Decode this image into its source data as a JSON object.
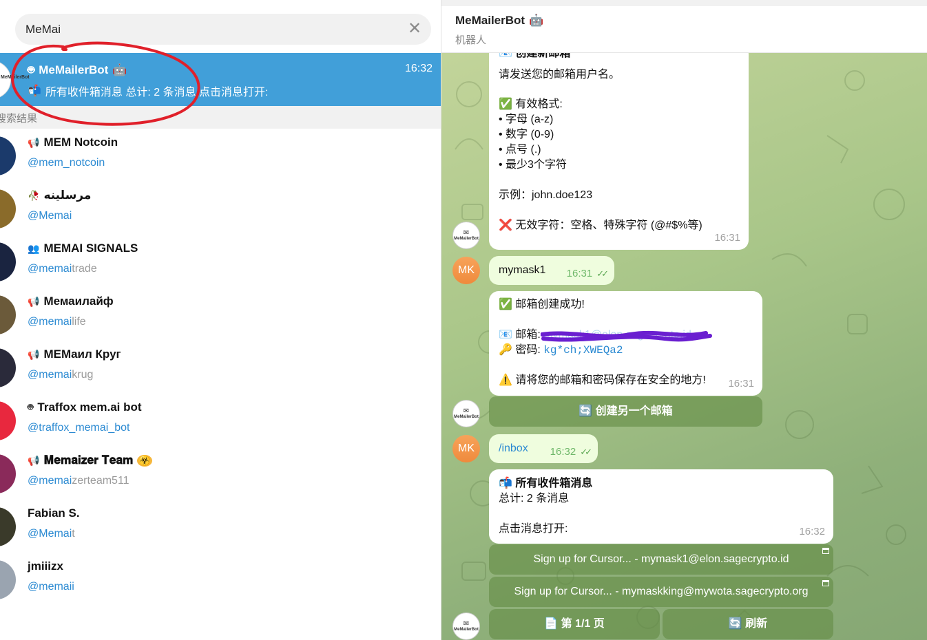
{
  "search": {
    "value": "MeMai"
  },
  "active_chat": {
    "name": "MeMailerBot",
    "time": "16:32",
    "preview": "所有收件箱消息 总计: 2 条消息  点击消息打开:",
    "avatar_text": "MeMailerBot"
  },
  "section_label": "搜索结果",
  "results": [
    {
      "name": "MEM Notcoin",
      "type_icon": "channel-icon",
      "handle_hl": "@mem_notcoin",
      "handle_rest": ""
    },
    {
      "name": "مرسلينه",
      "type_icon": "rose-icon",
      "handle_hl": "@Memai",
      "handle_rest": ""
    },
    {
      "name": "MEMAI SIGNALS",
      "type_icon": "group-icon",
      "handle_hl": "@memai",
      "handle_rest": "trade"
    },
    {
      "name": "Мемаилайф",
      "type_icon": "channel-icon",
      "handle_hl": "@memai",
      "handle_rest": "life"
    },
    {
      "name": "MEMаил Круг",
      "type_icon": "channel-icon",
      "handle_hl": "@memai",
      "handle_rest": "krug"
    },
    {
      "name": "Traffox mem.ai bot",
      "type_icon": "bot-icon",
      "handle_hl": "@traffox_memai_bot",
      "handle_rest": ""
    },
    {
      "name": "𝐌𝐞𝐦𝐚𝐢𝐳𝐞𝐫 𝐓𝐞𝐚𝐦",
      "type_icon": "channel-icon",
      "handle_hl": "@memai",
      "handle_rest": "zerteam511"
    },
    {
      "name": "Fabian S.",
      "type_icon": "",
      "handle_hl": "@Memai",
      "handle_rest": "t"
    },
    {
      "name": "jmiiizx",
      "type_icon": "",
      "handle_hl": "@memaii",
      "handle_rest": ""
    }
  ],
  "header": {
    "name": "MeMailerBot",
    "status": "机器人"
  },
  "messages": {
    "create_title": "创建新邮箱",
    "create_prompt": "请发送您的邮箱用户名。",
    "valid_format": "有效格式:",
    "rule1": "• 字母 (a-z)",
    "rule2": "• 数字 (0-9)",
    "rule3": "• 点号 (.)",
    "rule4": "• 最少3个字符",
    "example": "示例：john.doe123",
    "invalid": "无效字符：空格、特殊字符 (@#$%等)",
    "t1": "16:31",
    "user1": "mymask1",
    "t2": "16:31",
    "success": "邮箱创建成功!",
    "email_label": "邮箱:",
    "email_value": "mymask1@elon.sagecrypto.id",
    "password_label": "密码:",
    "password_value": "kg*ch;XWEQa2",
    "warning": "请将您的邮箱和密码保存在安全的地方!",
    "t3": "16:31",
    "create_another": "创建另一个邮箱",
    "user2": "/inbox",
    "t4": "16:32",
    "inbox_title": "所有收件箱消息",
    "inbox_total": "总计: 2 条消息",
    "inbox_click": "点击消息打开:",
    "t5": "16:32",
    "mail1": "Sign up for Cursor... - mymask1@elon.sagecrypto.id",
    "mail2": "Sign up for Cursor... - mymaskking@mywota.sagecrypto.org",
    "page": "第 1/1 页",
    "refresh": "刷新",
    "mk_initials": "MK",
    "bot_avatar_text": "MeMailerBot"
  },
  "colors": {
    "accent": "#419fd9",
    "link": "#2b8ad2",
    "redaction": "#6a1fd0",
    "annotation": "#e0202a"
  }
}
